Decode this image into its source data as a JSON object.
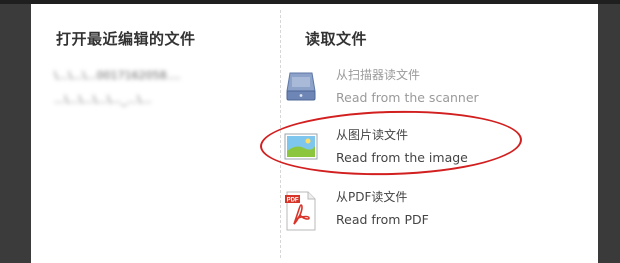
{
  "recent": {
    "title": "打开最近编辑的文件",
    "items": [
      "\\...\\...\\...0017162058....",
      "...\\...\\...\\...\\..._...\\..."
    ]
  },
  "read": {
    "title": "读取文件",
    "options": [
      {
        "label_cn": "从扫描器读文件",
        "label_en": "Read from the scanner",
        "icon": "scanner-icon"
      },
      {
        "label_cn": "从图片读文件",
        "label_en": "Read from the image",
        "icon": "image-icon"
      },
      {
        "label_cn": "从PDF读文件",
        "label_en": "Read from PDF",
        "icon": "pdf-icon"
      }
    ]
  },
  "colors": {
    "annotation": "#d21f1f",
    "pdf_red": "#d8352a",
    "scanner_blue": "#6d86b5"
  }
}
